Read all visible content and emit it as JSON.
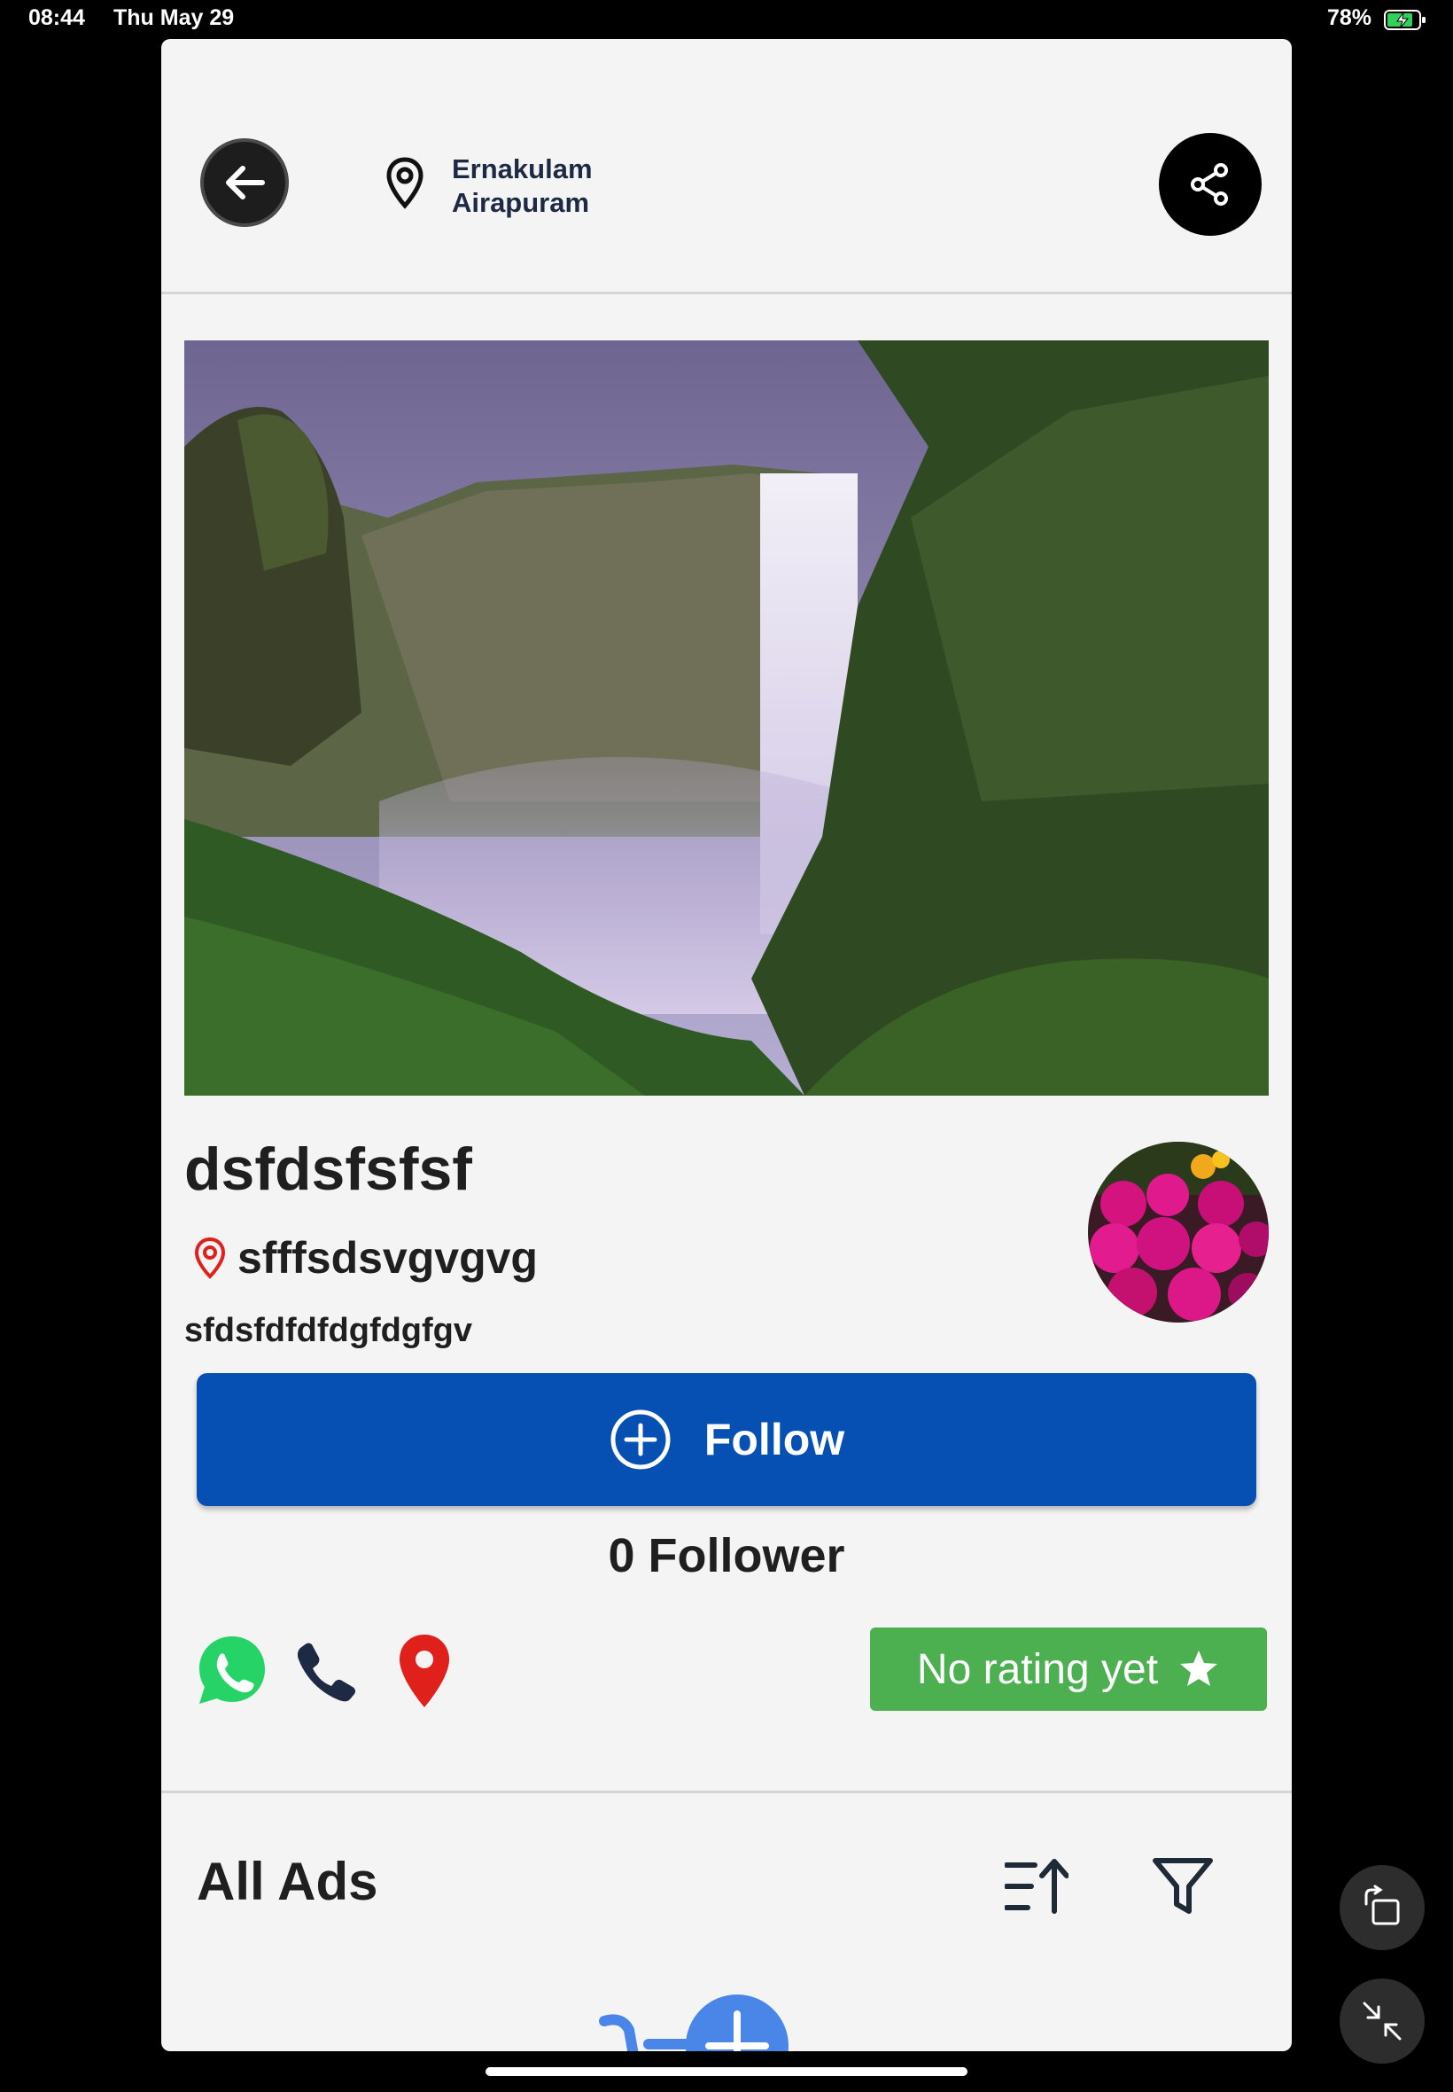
{
  "status_bar": {
    "time": "08:44",
    "date": "Thu May 29",
    "battery": "78%"
  },
  "header": {
    "location_line1": "Ernakulam",
    "location_line2": "Airapuram"
  },
  "profile": {
    "name": "dsfdsfsfsf",
    "address": "sfffsdsvgvgvg",
    "description": "sfdsfdfdfdgfdgfgv"
  },
  "follow_button": {
    "label": "Follow"
  },
  "followers_text": "0 Follower",
  "rating": {
    "label": "No rating yet"
  },
  "ads_section": {
    "title": "All Ads"
  },
  "colors": {
    "follow_blue": "#0650b4",
    "rating_green": "#4caf50",
    "whatsapp_green": "#25d366",
    "pin_red": "#e0201a",
    "background": "#f4f4f4"
  }
}
